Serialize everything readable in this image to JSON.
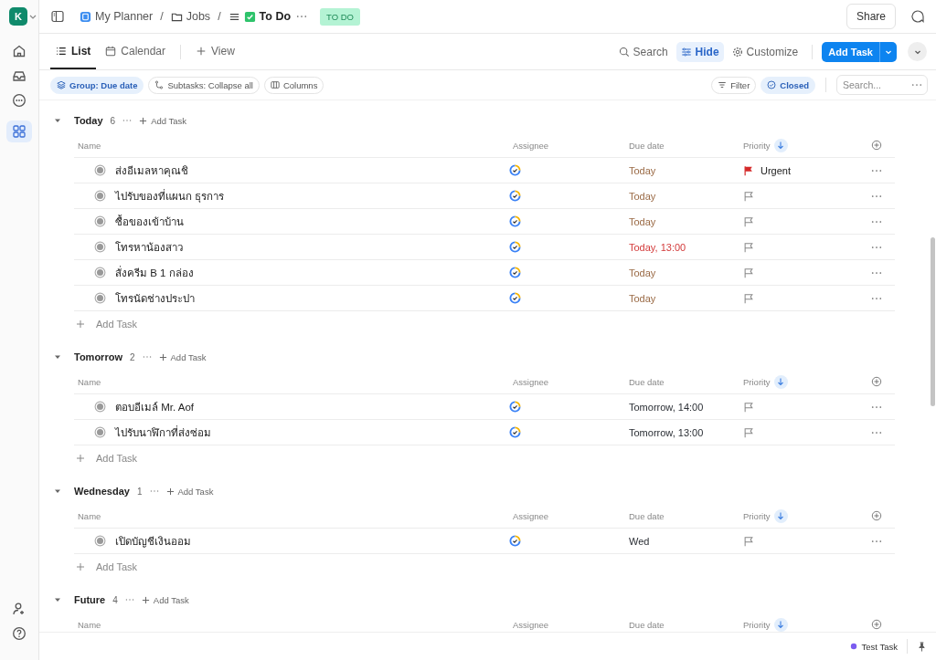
{
  "workspace": {
    "initial": "K"
  },
  "breadcrumb": [
    {
      "label": "My Planner",
      "kind": "planner"
    },
    {
      "sep": "/",
      "label": "Jobs",
      "kind": "folder"
    },
    {
      "sep": "/",
      "label": "To Do",
      "kind": "list"
    }
  ],
  "status_badge": "TO DO",
  "share": "Share",
  "view_tabs": [
    {
      "label": "List",
      "kind": "list",
      "selected": true
    },
    {
      "label": "Calendar",
      "kind": "calendar",
      "selected": false
    }
  ],
  "add_view": "View",
  "toolbar": {
    "search": "Search",
    "hide": "Hide",
    "customize": "Customize",
    "add_task": "Add Task"
  },
  "chips": [
    {
      "label": "Group: Due date",
      "kind": "group",
      "selected": true
    },
    {
      "label": "Subtasks: Collapse all",
      "kind": "subtasks",
      "selected": false
    },
    {
      "label": "Columns",
      "kind": "columns",
      "selected": false
    }
  ],
  "filters": [
    {
      "label": "Filter",
      "kind": "filter",
      "selected": false
    },
    {
      "label": "Closed",
      "kind": "closed",
      "selected": true
    }
  ],
  "search_placeholder": "Search...",
  "groups": [
    {
      "title": "Today",
      "count": "6",
      "expanded": true,
      "add": "Add Task",
      "add_row": "Add Task",
      "columns": [
        "Name",
        "Assignee",
        "Due date",
        "Priority"
      ],
      "tasks": [
        {
          "name": "ส่งอีเมลหาคุณชิ",
          "due": {
            "text": "Today",
            "color": "#9a6a45"
          },
          "priority": {
            "kind": "urgent",
            "label": "Urgent"
          }
        },
        {
          "name": "ไปรับของที่แผนก ธุรการ",
          "due": {
            "text": "Today",
            "color": "#9a6a45"
          },
          "priority": {
            "kind": "none"
          }
        },
        {
          "name": "ซื้อของเข้าบ้าน",
          "due": {
            "text": "Today",
            "color": "#9a6a45"
          },
          "priority": {
            "kind": "none"
          }
        },
        {
          "name": "โทรหาน้องสาว",
          "due": {
            "text": "Today, 13:00",
            "color": "#d33a3a"
          },
          "priority": {
            "kind": "none"
          }
        },
        {
          "name": "สั่งครีม B 1 กล่อง",
          "due": {
            "text": "Today",
            "color": "#9a6a45"
          },
          "priority": {
            "kind": "none"
          }
        },
        {
          "name": "โทรนัดช่างประปา",
          "due": {
            "text": "Today",
            "color": "#9a6a45"
          },
          "priority": {
            "kind": "none"
          }
        }
      ]
    },
    {
      "title": "Tomorrow",
      "count": "2",
      "expanded": true,
      "add": "Add Task",
      "add_row": "Add Task",
      "columns": [
        "Name",
        "Assignee",
        "Due date",
        "Priority"
      ],
      "tasks": [
        {
          "name": "ตอบอีเมล์ Mr. Aof",
          "due": {
            "text": "Tomorrow, 14:00",
            "color": "#2a2e34"
          },
          "priority": {
            "kind": "none"
          }
        },
        {
          "name": "ไปรับนาฬิกาที่ส่งซ่อม",
          "due": {
            "text": "Tomorrow, 13:00",
            "color": "#2a2e34"
          },
          "priority": {
            "kind": "none"
          }
        }
      ]
    },
    {
      "title": "Wednesday",
      "count": "1",
      "expanded": true,
      "add": "Add Task",
      "add_row": "Add Task",
      "columns": [
        "Name",
        "Assignee",
        "Due date",
        "Priority"
      ],
      "tasks": [
        {
          "name": "เปิดบัญชีเงินออม",
          "due": {
            "text": "Wed",
            "color": "#2a2e34"
          },
          "priority": {
            "kind": "none"
          }
        }
      ]
    },
    {
      "title": "Future",
      "count": "4",
      "expanded": true,
      "add": "Add Task",
      "columns": [
        "Name",
        "Assignee",
        "Due date",
        "Priority"
      ]
    }
  ],
  "footer": {
    "task": "Test Task"
  }
}
